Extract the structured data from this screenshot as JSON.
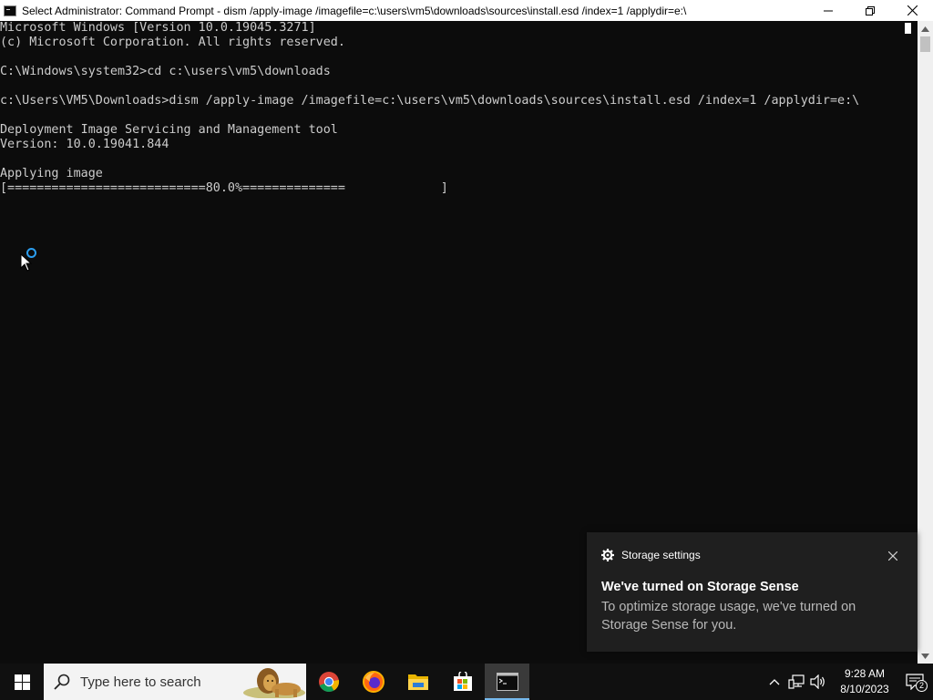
{
  "window": {
    "title": "Select Administrator:  Command Prompt - dism  /apply-image /imagefile=c:\\users\\vm5\\downloads\\sources\\install.esd /index=1 /applydir=e:\\"
  },
  "console": {
    "lines": [
      "Microsoft Windows [Version 10.0.19045.3271]",
      "(c) Microsoft Corporation. All rights reserved.",
      "",
      "C:\\Windows\\system32>cd c:\\users\\vm5\\downloads",
      "",
      "c:\\Users\\VM5\\Downloads>dism /apply-image /imagefile=c:\\users\\vm5\\downloads\\sources\\install.esd /index=1 /applydir=e:\\",
      "",
      "Deployment Image Servicing and Management tool",
      "Version: 10.0.19041.844",
      "",
      "Applying image",
      "[===========================80.0%==============             ]"
    ]
  },
  "toast": {
    "app_name": "Storage settings",
    "title": "We've turned on Storage Sense",
    "body": "To optimize storage usage, we've turned on Storage Sense for you."
  },
  "taskbar": {
    "search_placeholder": "Type here to search",
    "apps": [
      {
        "name": "chrome-icon"
      },
      {
        "name": "firefox-icon"
      },
      {
        "name": "file-explorer-icon"
      },
      {
        "name": "microsoft-store-icon"
      },
      {
        "name": "command-prompt-icon",
        "active": true
      }
    ],
    "time": "9:28 AM",
    "date": "8/10/2023",
    "notification_count": "2"
  },
  "colors": {
    "console_bg": "#0c0c0c",
    "console_text": "#cccccc",
    "taskbar_bg": "#101010",
    "toast_bg": "#1f1f1f",
    "accent": "#76b9ed"
  }
}
